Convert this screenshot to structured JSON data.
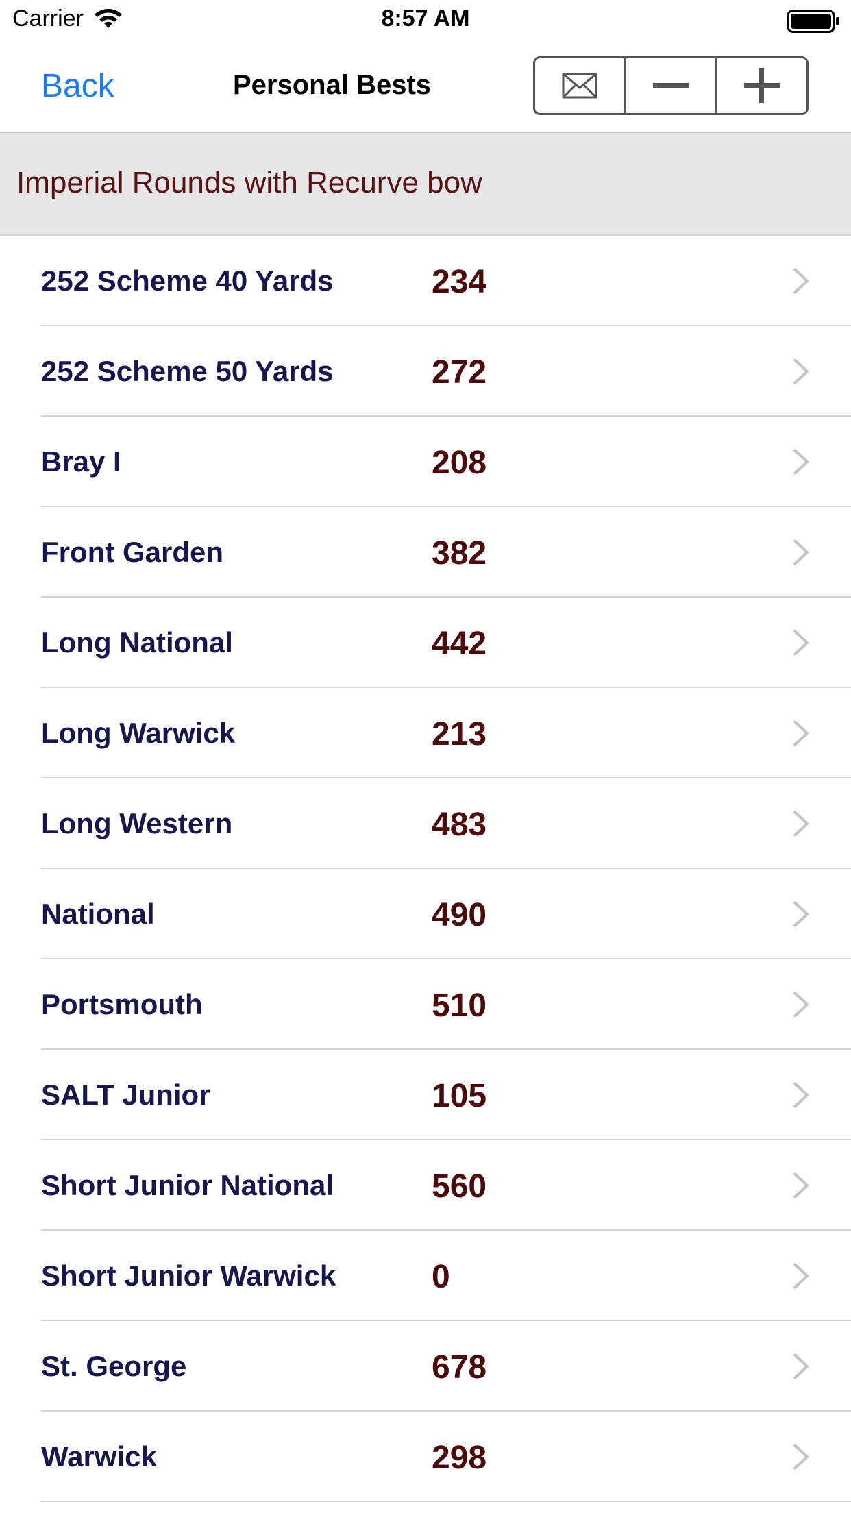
{
  "status_bar": {
    "carrier": "Carrier",
    "time": "8:57 AM",
    "wifi_icon": "wifi-icon",
    "battery_icon": "battery-icon"
  },
  "nav": {
    "back_label": "Back",
    "title": "Personal Bests",
    "accent_color": "#1a7ef2",
    "actions": [
      "mail-icon",
      "minus-icon",
      "plus-icon"
    ]
  },
  "section": {
    "title": "Imperial Rounds with Recurve bow"
  },
  "rows": [
    {
      "name": "252 Scheme 40 Yards",
      "score": "234"
    },
    {
      "name": "252 Scheme 50 Yards",
      "score": "272"
    },
    {
      "name": "Bray I",
      "score": "208"
    },
    {
      "name": "Front Garden",
      "score": "382"
    },
    {
      "name": "Long National",
      "score": "442"
    },
    {
      "name": "Long Warwick",
      "score": "213"
    },
    {
      "name": "Long Western",
      "score": "483"
    },
    {
      "name": "National",
      "score": "490"
    },
    {
      "name": "Portsmouth",
      "score": "510"
    },
    {
      "name": "SALT Junior",
      "score": "105"
    },
    {
      "name": "Short Junior National",
      "score": "560"
    },
    {
      "name": "Short Junior Warwick",
      "score": "0"
    },
    {
      "name": "St. George",
      "score": "678"
    },
    {
      "name": "Warwick",
      "score": "298"
    }
  ]
}
